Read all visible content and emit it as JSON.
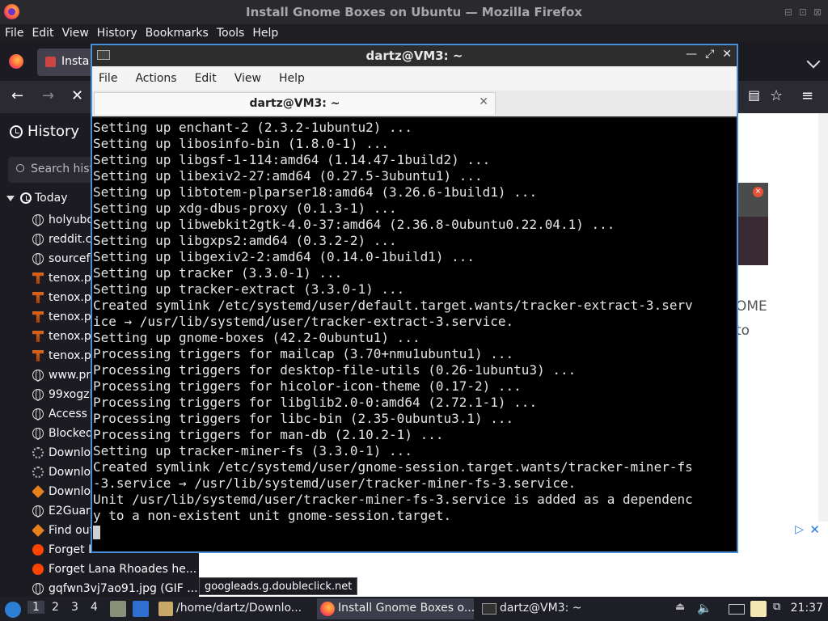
{
  "firefox": {
    "window_title": "Install Gnome Boxes on Ubuntu — Mozilla Firefox",
    "menu": [
      "File",
      "Edit",
      "View",
      "History",
      "Bookmarks",
      "Tools",
      "Help"
    ],
    "tab_label": "Insta",
    "sidebar": {
      "title": "History",
      "search_placeholder": "Search hist",
      "group": "Today",
      "items": [
        {
          "icon": "globe-icon",
          "label": "holyubo"
        },
        {
          "icon": "globe-icon",
          "label": "reddit.c"
        },
        {
          "icon": "globe-icon",
          "label": "sourcef"
        },
        {
          "icon": "tenox-icon",
          "label": "tenox.p"
        },
        {
          "icon": "tenox-icon",
          "label": "tenox.p"
        },
        {
          "icon": "tenox-icon",
          "label": "tenox.p"
        },
        {
          "icon": "tenox-icon",
          "label": "tenox.p"
        },
        {
          "icon": "tenox-icon",
          "label": "tenox.p"
        },
        {
          "icon": "globe-icon",
          "label": "www.pr"
        },
        {
          "icon": "globe-icon",
          "label": "99xogzl"
        },
        {
          "icon": "globe-icon",
          "label": "Access"
        },
        {
          "icon": "globe-icon",
          "label": "Blocked"
        },
        {
          "icon": "spinner-icon",
          "label": "Downlo"
        },
        {
          "icon": "spinner-icon",
          "label": "Downlo"
        },
        {
          "icon": "diamond-icon",
          "label": "Downlo"
        },
        {
          "icon": "globe-icon",
          "label": "E2Guar"
        },
        {
          "icon": "diamond-icon",
          "label": "Find out"
        },
        {
          "icon": "reddit-icon",
          "label": "Forget L"
        },
        {
          "icon": "reddit-icon",
          "label": "Forget Lana Rhoades he..."
        },
        {
          "icon": "globe-icon",
          "label": "gqfwn3vj7ao91.jpg (GIF ..."
        }
      ]
    },
    "page_text": [
      "OME",
      "to"
    ],
    "status_url": "googleads.g.doubleclick.net"
  },
  "terminal": {
    "title": "dartz@VM3: ~",
    "tab_title": "dartz@VM3: ~",
    "menu": [
      "File",
      "Actions",
      "Edit",
      "View",
      "Help"
    ],
    "lines": [
      "Setting up enchant-2 (2.3.2-1ubuntu2) ...",
      "Setting up libosinfo-bin (1.8.0-1) ...",
      "Setting up libgsf-1-114:amd64 (1.14.47-1build2) ...",
      "Setting up libexiv2-27:amd64 (0.27.5-3ubuntu1) ...",
      "Setting up libtotem-plparser18:amd64 (3.26.6-1build1) ...",
      "Setting up xdg-dbus-proxy (0.1.3-1) ...",
      "Setting up libwebkit2gtk-4.0-37:amd64 (2.36.8-0ubuntu0.22.04.1) ...",
      "Setting up libgxps2:amd64 (0.3.2-2) ...",
      "Setting up libgexiv2-2:amd64 (0.14.0-1build1) ...",
      "Setting up tracker (3.3.0-1) ...",
      "Setting up tracker-extract (3.3.0-1) ...",
      "Created symlink /etc/systemd/user/default.target.wants/tracker-extract-3.serv",
      "ice → /usr/lib/systemd/user/tracker-extract-3.service.",
      "Setting up gnome-boxes (42.2-0ubuntu1) ...",
      "Processing triggers for mailcap (3.70+nmu1ubuntu1) ...",
      "Processing triggers for desktop-file-utils (0.26-1ubuntu3) ...",
      "Processing triggers for hicolor-icon-theme (0.17-2) ...",
      "Processing triggers for libglib2.0-0:amd64 (2.72.1-1) ...",
      "Processing triggers for libc-bin (2.35-0ubuntu3.1) ...",
      "Processing triggers for man-db (2.10.2-1) ...",
      "Setting up tracker-miner-fs (3.3.0-1) ...",
      "Created symlink /etc/systemd/user/gnome-session.target.wants/tracker-miner-fs",
      "-3.service → /usr/lib/systemd/user/tracker-miner-fs-3.service.",
      "Unit /usr/lib/systemd/user/tracker-miner-fs-3.service is added as a dependenc",
      "y to a non-existent unit gnome-session.target."
    ]
  },
  "taskbar": {
    "workspaces": [
      "1",
      "2",
      "3",
      "4"
    ],
    "tasks": [
      {
        "label": "/home/dartz/Downlo...",
        "icon": "folder-icon"
      },
      {
        "label": "Install Gnome Boxes o...",
        "icon": "firefox-icon"
      },
      {
        "label": "dartz@VM3: ~",
        "icon": "terminal-icon"
      }
    ],
    "clock": "21:37"
  },
  "colors": {
    "accent_border": "#4a90d9",
    "terminal_bg": "#000000",
    "terminal_fg": "#e4e4e4"
  }
}
